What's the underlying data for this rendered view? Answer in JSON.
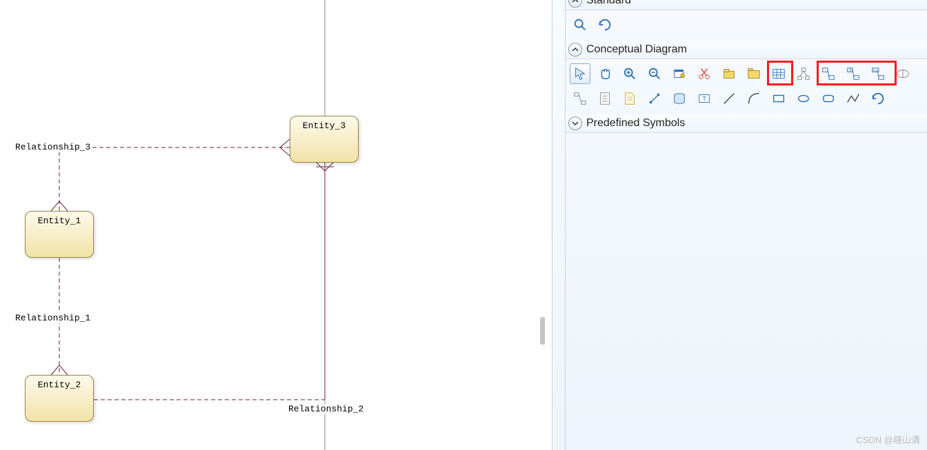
{
  "canvas": {
    "entities": {
      "e1": "Entity_1",
      "e2": "Entity_2",
      "e3": "Entity_3"
    },
    "relationships": {
      "r1": "Relationship_1",
      "r2": "Relationship_2",
      "r3": "Relationship_3"
    }
  },
  "panel": {
    "sections": {
      "standard": {
        "title": "Standard"
      },
      "conceptual": {
        "title": "Conceptual Diagram"
      },
      "predefined": {
        "title": "Predefined Symbols"
      }
    }
  },
  "tools_standard": {
    "zoom": "zoom-icon",
    "undo": "undo-icon"
  },
  "tools_conceptual": {
    "row1": [
      "pointer",
      "grabber",
      "zoom-in",
      "zoom-out",
      "properties",
      "cut",
      "open",
      "package",
      "entity",
      "association",
      "relationship",
      "rel-dep",
      "rel-nn"
    ],
    "row2": [
      "inheritance",
      "assoc-link",
      "note",
      "file-note",
      "link",
      "table",
      "title",
      "line",
      "arc",
      "rectangle",
      "ellipse",
      "rounded-rect",
      "polyline"
    ],
    "row3": [
      "symbol"
    ]
  },
  "watermark": "CSDN @晓山清"
}
